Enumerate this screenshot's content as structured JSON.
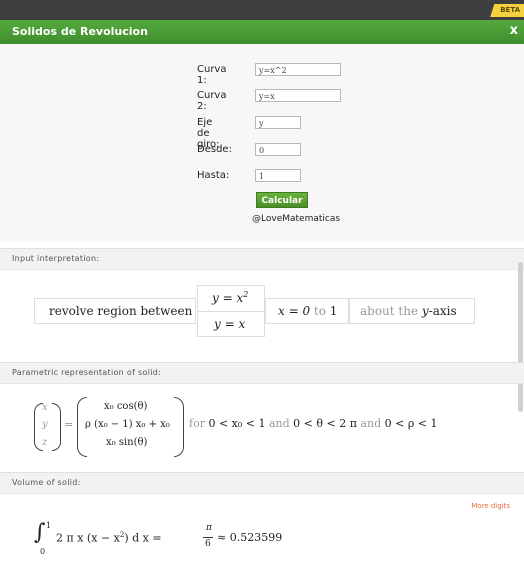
{
  "badge": "BETA",
  "header": {
    "title": "Solidos de Revolucion",
    "close": "x"
  },
  "form": {
    "fields": [
      {
        "label": "Curva 1:",
        "value": "y=x^2"
      },
      {
        "label": "Curva 2:",
        "value": "y=x"
      },
      {
        "label": "Eje de giro:",
        "value": "y"
      },
      {
        "label": "Desde:",
        "value": "0"
      },
      {
        "label": "Hasta:",
        "value": "1"
      }
    ],
    "submit_label": "Calcular",
    "credit": "@LoveMatematicas"
  },
  "sections": {
    "input": {
      "title": "Input interpretation:",
      "phrase": "revolve region between",
      "curve_top": "y = x",
      "curve_top_exp": "2",
      "curve_bottom": "y = x",
      "range_x": "x = 0",
      "range_to": "to",
      "range_end": "1",
      "about": "about the",
      "axis_var": "y",
      "axis_suffix": "-axis"
    },
    "parametric": {
      "title": "Parametric representation of solid:",
      "vec_x": "x",
      "vec_y": "y",
      "vec_z": "z",
      "equals": "=",
      "row1": "x₀ cos(θ)",
      "row2": "ρ (x₀ − 1) x₀ + x₀",
      "row3": "x₀ sin(θ)",
      "for": "for",
      "c1": "0 < x₀ < 1",
      "and1": "and",
      "c2": "0 < θ < 2 π",
      "and2": "and",
      "c3": "0 < ρ < 1"
    },
    "volume": {
      "title": "Volume of solid:",
      "more_digits": "More digits",
      "int_upper": "1",
      "int_lower": "0",
      "integrand": "2 π x (x − x",
      "integrand_exp": "2",
      "integrand_end": ") d x =",
      "frac_num": "π",
      "frac_den": "6",
      "approx": "≈ 0.523599"
    }
  }
}
